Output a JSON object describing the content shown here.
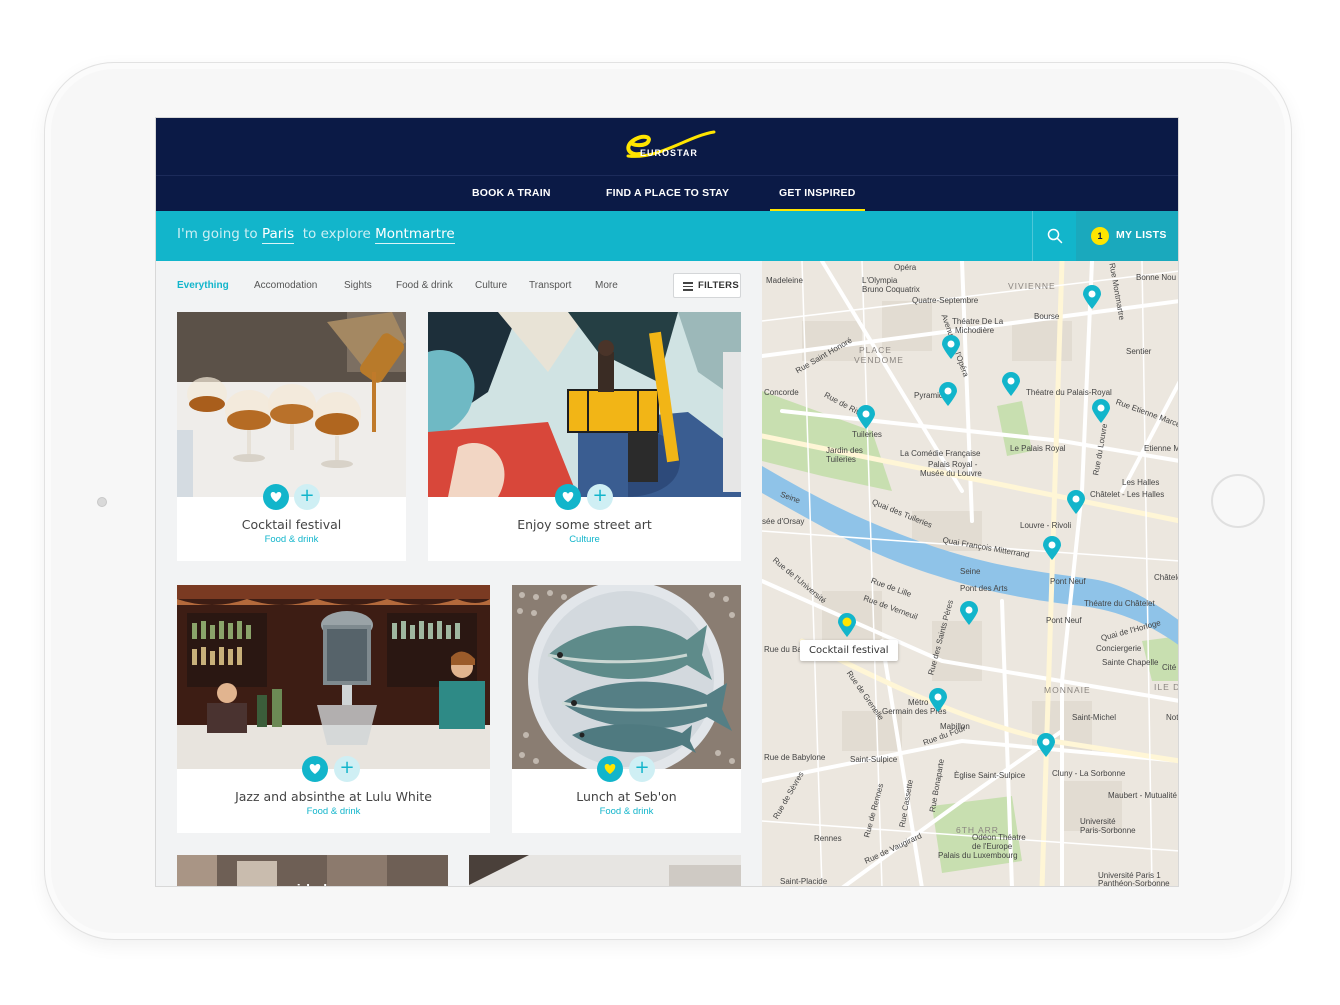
{
  "header": {
    "brand": "EUROSTAR",
    "nav": [
      {
        "label": "BOOK A TRAIN",
        "active": false
      },
      {
        "label": "FIND A PLACE TO STAY",
        "active": false
      },
      {
        "label": "GET INSPIRED",
        "active": true
      }
    ]
  },
  "search": {
    "prefix": "I'm going to",
    "city": "Paris",
    "middle": "to explore",
    "area": "Montmartre"
  },
  "my_lists": {
    "count": "1",
    "label": "MY LISTS"
  },
  "filters": {
    "tabs": [
      "Everything",
      "Accomodation",
      "Sights",
      "Food & drink",
      "Culture",
      "Transport",
      "More"
    ],
    "active_tab": "Everything",
    "button_label": "FILTERS"
  },
  "cards": [
    {
      "title": "Cocktail festival",
      "category": "Food & drink",
      "favorited": false
    },
    {
      "title": "Enjoy some street art",
      "category": "Culture",
      "favorited": false
    },
    {
      "title": "Jazz and absinthe at Lulu White",
      "category": "Food & drink",
      "favorited": false
    },
    {
      "title": "Lunch at Seb'on",
      "category": "Food & drink",
      "favorited": true
    }
  ],
  "partial_cards": [
    {
      "title": "airbnb"
    }
  ],
  "map": {
    "tooltip": "Cocktail festival",
    "labels": [
      "Opéra",
      "Madeleine",
      "L'Olympia",
      "Bruno Coquatrix",
      "Quatre-Septembre",
      "VIVIENNE",
      "Bonne Nou",
      "Théatre De La",
      "Michodière",
      "Bourse",
      "Rue Saint Honoré",
      "PLACE",
      "VENDOME",
      "Sentier",
      "Concorde",
      "Pyramides",
      "Théatre du Palais-Royal",
      "Rue de Rivoli",
      "Tuileries",
      "Rue Etienne Marcel",
      "Jardin des",
      "Tuileries",
      "La Comédie Française",
      "Le Palais Royal",
      "Etienne M",
      "Palais Royal -",
      "Musée du Louvre",
      "Les Halles",
      "Châtelet - Les Halles",
      "Seine",
      "Quai des Tuileries",
      "Quai François Mitterrand",
      "Louvre - Rivoli",
      "sée d'Orsay",
      "Pont Neuf",
      "Rue de l'Université",
      "Seine",
      "Pont des Arts",
      "Châtelet",
      "Rue de Lille",
      "Rue de Verneuil",
      "Théatre du Châtelet",
      "Pont Neuf",
      "Quai de l'Horloge",
      "Conciergerie",
      "Rue du Bac",
      "Sainte Chapelle",
      "Cité",
      "MONNAIE",
      "ILE DE",
      "Rue de Grenelle",
      "Métro",
      "Germain des Prés",
      "Mabillon",
      "Saint-Michel",
      "Notre",
      "Rue de Babylone",
      "Rue du Four",
      "Saint-Sulpice",
      "Cluny - La Sorbonne",
      "Maubert - Mutualité",
      "Èglise Saint-Sulpice",
      "Rue de Vaugirard",
      "Odéon Théatre",
      "de l'Europe",
      "Université",
      "Paris-Sorbonne",
      "6TH ARR",
      "Rennes",
      "Palais du Luxembourg",
      "Saint-Placide",
      "Université Paris 1",
      "Panthéon-Sorbonne",
      "Rue de Sèvres",
      "Rue Bonaparte",
      "Rue de Rennes",
      "Rue Cassette",
      "Rue des Saints Pères",
      "Rue du Louvre",
      "Rue Montmartre",
      "Avenue de l'Opéra"
    ]
  },
  "colors": {
    "navy": "#0b1a46",
    "accent": "#12b5cb",
    "highlight": "#ffe500",
    "map_land": "#ece7df",
    "map_park": "#c8dfb0",
    "map_water": "#8fc3e8"
  }
}
